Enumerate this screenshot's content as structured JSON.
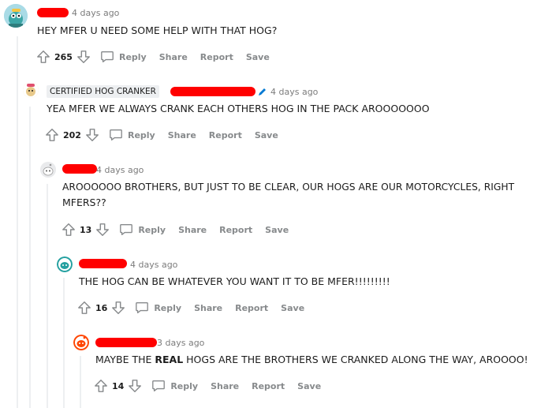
{
  "comments": [
    {
      "timestamp": "4 days ago",
      "text": "HEY MFER U NEED SOME HELP WITH THAT HOG?",
      "votes": "265",
      "actions": [
        "Reply",
        "Share",
        "Report",
        "Save"
      ]
    },
    {
      "flair": "CERTIFIED HOG CRANKER",
      "timestamp": "4 days ago",
      "text": "YEA MFER WE ALWAYS CRANK EACH OTHERS HOG IN THE PACK AROOOOOOO",
      "votes": "202",
      "actions": [
        "Reply",
        "Share",
        "Report",
        "Save"
      ]
    },
    {
      "timestamp": "4 days ago",
      "text_line1": "AROOOOOO BROTHERS, BUT JUST TO BE CLEAR, OUR HOGS ARE OUR MOTORCYCLES, RIGHT",
      "text_line2": "MFERS??",
      "votes": "13",
      "actions": [
        "Reply",
        "Share",
        "Report",
        "Save"
      ]
    },
    {
      "timestamp": "4 days ago",
      "text": "THE HOG CAN BE WHATEVER YOU WANT IT TO BE MFER!!!!!!!!!",
      "votes": "16",
      "actions": [
        "Reply",
        "Share",
        "Report",
        "Save"
      ]
    },
    {
      "timestamp": "3 days ago",
      "text_before": "MAYBE THE ",
      "text_bold": "REAL",
      "text_after": " HOGS ARE THE BROTHERS WE CRANKED ALONG THE WAY, AROOOO!",
      "votes": "14",
      "actions": [
        "Reply",
        "Share",
        "Report",
        "Save"
      ]
    }
  ],
  "colors": {
    "redaction": "#ff0000",
    "thread_line": "#edeff1",
    "meta_text": "#7c7c7c",
    "action_text": "#878a8c",
    "flair_bg": "#edeff1",
    "pencil": "#0079d3"
  },
  "icons": [
    "avatar",
    "upvote-arrow-icon",
    "downvote-arrow-icon",
    "comment-bubble-icon",
    "pencil-icon"
  ]
}
